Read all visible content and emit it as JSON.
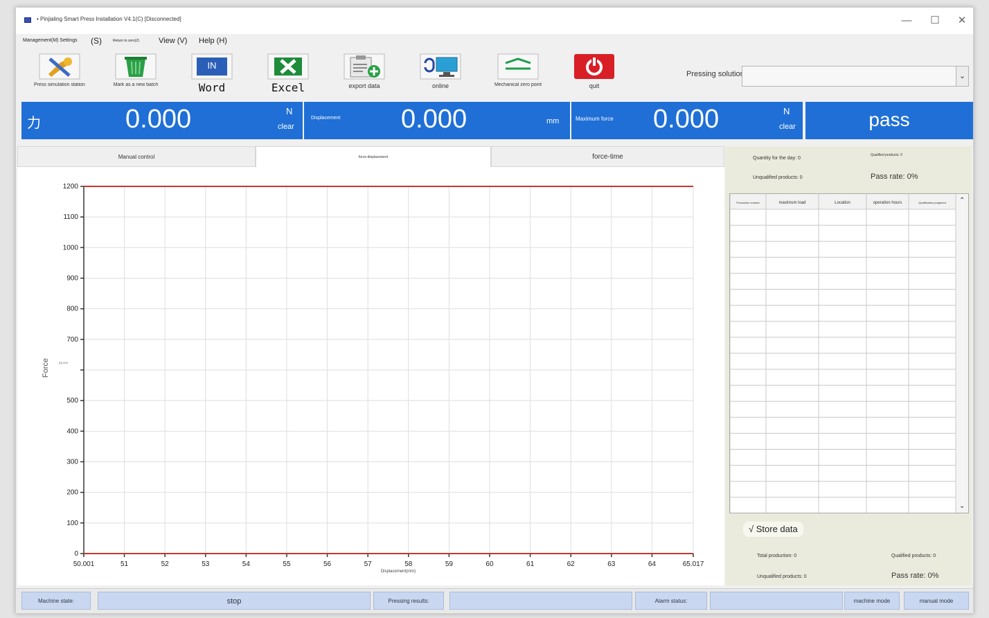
{
  "window": {
    "title": "• Pinjialing Smart Press Installation V4.1(C) [Disconnected]",
    "minimize": "—",
    "maximize": "☐",
    "close": "✕"
  },
  "menu": {
    "management": "Management(M) Settings",
    "s": "(S)",
    "return": "Return to zero(Z)",
    "view": "View (V)",
    "help": "Help (H)"
  },
  "toolbar": {
    "items": [
      {
        "label": "Press simulation station"
      },
      {
        "label": "Mark as a new batch"
      },
      {
        "label": "Word",
        "icon_text": "IN"
      },
      {
        "label": "Excel"
      },
      {
        "label": "export data"
      },
      {
        "label": "online"
      },
      {
        "label": "Mechanical zero point"
      },
      {
        "label": "quit"
      }
    ],
    "solution_label": "Pressing solution position control",
    "solution_value": ""
  },
  "readouts": {
    "force": {
      "label": "力",
      "value": "0.000",
      "unit": "N",
      "clear": "clear"
    },
    "displacement": {
      "label": "Displacement",
      "value": "0.000",
      "unit": "mm"
    },
    "max_force": {
      "label": "Maximum force",
      "value": "0.000",
      "unit": "N",
      "clear": "clear"
    },
    "result": "pass"
  },
  "tabs": [
    {
      "label": "Manual control"
    },
    {
      "label": "force-displacement"
    },
    {
      "label": "force-time"
    }
  ],
  "stats_top": {
    "quantity_day": "Quantity for the day: 0",
    "qualified": "Qualified products: 0",
    "unqualified": "Unqualified products: 0",
    "pass_rate": "Pass rate: 0%"
  },
  "table": {
    "headers": [
      "Production number",
      "maximum load",
      "Location",
      "operation hours",
      "Qualification judgment"
    ]
  },
  "store_data": "√ Store data",
  "stats_bottom": {
    "total": "Total production: 0",
    "qualified": "Qualified products: 0",
    "unqualified": "Unqualified products: 0",
    "pass_rate": "Pass rate: 0%"
  },
  "status": {
    "machine_state_label": "Machine state:",
    "machine_state_value": "stop",
    "pressing_results_label": "Pressing results:",
    "pressing_results_value": "",
    "alarm_label": "Alarm status:",
    "alarm_value": "",
    "machine_mode": "machine mode",
    "manual_mode": "manual mode"
  },
  "chart_data": {
    "type": "line",
    "title": "",
    "xlabel": "Displacement(mm)",
    "ylabel": "Force",
    "y_unit_label": "[N] 600",
    "xlim": [
      50.001,
      65.017
    ],
    "ylim": [
      0,
      1200
    ],
    "x_ticks": [
      "50.001",
      "51",
      "52",
      "53",
      "54",
      "55",
      "56",
      "57",
      "58",
      "59",
      "60",
      "61",
      "62",
      "63",
      "64",
      "65.017"
    ],
    "y_ticks": [
      "0",
      "100",
      "200",
      "300",
      "400",
      "500",
      "",
      "700",
      "800",
      "900",
      "1000",
      "1100",
      "1200"
    ],
    "series": [
      {
        "values": [
          [
            50.001,
            1200
          ],
          [
            65.017,
            1200
          ]
        ]
      },
      {
        "values": [
          [
            50.001,
            0
          ],
          [
            65.017,
            0
          ]
        ]
      }
    ],
    "grid": true,
    "line_color": "#c0392b"
  }
}
